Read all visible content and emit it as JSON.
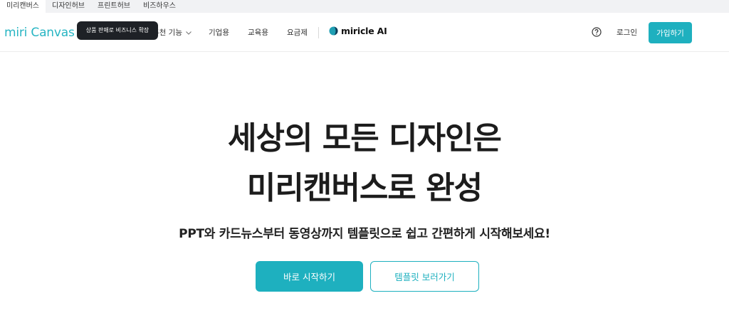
{
  "service_bar": {
    "tabs": [
      {
        "label": "미리캔버스",
        "active": true
      },
      {
        "label": "디자인허브",
        "active": false
      },
      {
        "label": "프린트허브",
        "active": false
      },
      {
        "label": "비즈하우스",
        "active": false
      }
    ]
  },
  "header": {
    "logo": "miri Canvas",
    "tooltip": "상품 판매로 비즈니스 확장",
    "nav": {
      "features": "추천 기능",
      "enterprise": "기업용",
      "education": "교육용",
      "pricing": "요금제"
    },
    "miricle_ai": "miricle AI",
    "help_icon": "question-circle-icon",
    "login": "로그인",
    "signup": "가입하기"
  },
  "hero": {
    "title_line1": "세상의 모든 디자인은",
    "title_line2": "미리캔버스로 완성",
    "subtitle": "PPT와 카드뉴스부터 동영상까지 템플릿으로 쉽고 간편하게 시작해보세요!",
    "primary_button": "바로 시작하기",
    "secondary_button": "템플릿 보러가기"
  },
  "colors": {
    "brand": "#1eb0bf",
    "logo": "#27b5c3",
    "tooltip_bg": "#1e2126"
  }
}
